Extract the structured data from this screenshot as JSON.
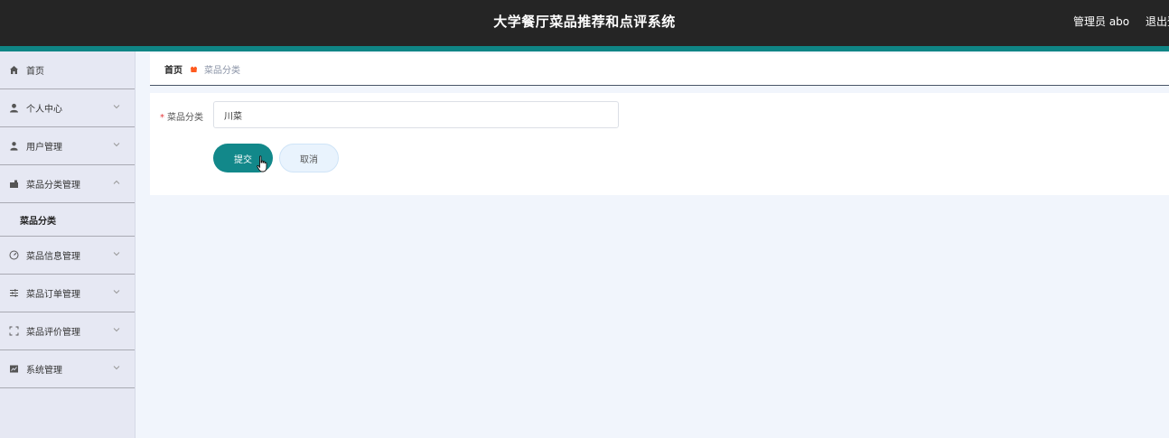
{
  "header": {
    "title": "大学餐厅菜品推荐和点评系统",
    "user": "管理员 abo",
    "logout": "退出登录"
  },
  "sidebar": {
    "items": [
      {
        "label": "首页",
        "icon": "home-icon"
      },
      {
        "label": "个人中心",
        "icon": "person-icon"
      },
      {
        "label": "用户管理",
        "icon": "user-icon"
      },
      {
        "label": "菜品分类管理",
        "icon": "folder-icon",
        "expanded": true,
        "children": [
          "菜品分类"
        ]
      },
      {
        "label": "菜品信息管理",
        "icon": "dashboard-icon"
      },
      {
        "label": "菜品订单管理",
        "icon": "sliders-icon"
      },
      {
        "label": "菜品评价管理",
        "icon": "fullscreen-icon"
      },
      {
        "label": "系统管理",
        "icon": "chart-icon"
      }
    ]
  },
  "breadcrumb": {
    "home": "首页",
    "current": "菜品分类"
  },
  "form": {
    "category_label": "菜品分类",
    "category_value": "川菜",
    "submit_label": "提交",
    "cancel_label": "取消"
  },
  "colors": {
    "accent": "#12888a",
    "header_bg": "#252525",
    "sidebar_bg": "#e6e8f3",
    "breadcrumb_icon": "#ff5a1f"
  }
}
